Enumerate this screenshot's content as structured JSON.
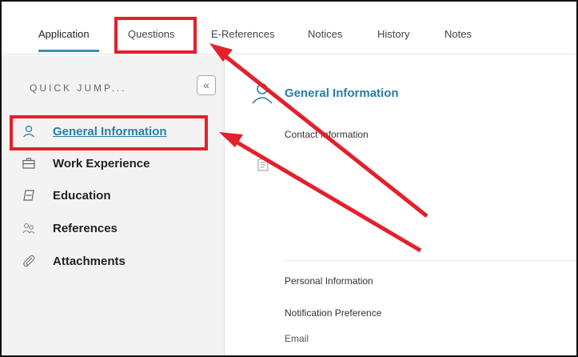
{
  "tabs": [
    {
      "label": "Application",
      "active": true
    },
    {
      "label": "Questions",
      "active": false
    },
    {
      "label": "E-References",
      "active": false
    },
    {
      "label": "Notices",
      "active": false
    },
    {
      "label": "History",
      "active": false
    },
    {
      "label": "Notes",
      "active": false
    }
  ],
  "sidebar": {
    "heading": "QUICK JUMP...",
    "collapse_glyph": "«",
    "items": [
      {
        "label": "General Information",
        "icon": "person-icon",
        "active": true
      },
      {
        "label": "Work Experience",
        "icon": "briefcase-icon",
        "active": false
      },
      {
        "label": "Education",
        "icon": "education-icon",
        "active": false
      },
      {
        "label": "References",
        "icon": "people-icon",
        "active": false
      },
      {
        "label": "Attachments",
        "icon": "paperclip-icon",
        "active": false
      }
    ]
  },
  "main": {
    "title": "General Information",
    "contact_heading": "Contact Information",
    "personal_heading": "Personal Information",
    "notification_heading": "Notification Preference",
    "notification_value": "Email"
  },
  "colors": {
    "accent": "#2a7da7",
    "annotation": "#e3202b",
    "sidebar_bg": "#f3f3f3"
  }
}
